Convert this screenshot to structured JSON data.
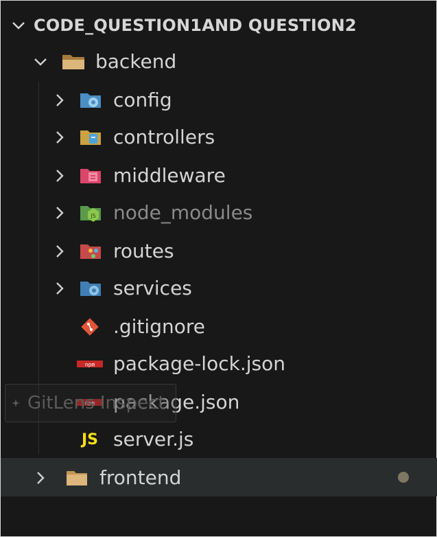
{
  "explorer": {
    "workspace_title": "CODE_QUESTION1AND QUESTION2",
    "backend": {
      "label": "backend",
      "children": [
        {
          "label": "config",
          "icon": "config-folder-icon",
          "dim": false
        },
        {
          "label": "controllers",
          "icon": "controllers-folder-icon",
          "dim": false
        },
        {
          "label": "middleware",
          "icon": "middleware-folder-icon",
          "dim": false
        },
        {
          "label": "node_modules",
          "icon": "node-modules-folder-icon",
          "dim": true
        },
        {
          "label": "routes",
          "icon": "routes-folder-icon",
          "dim": false
        },
        {
          "label": "services",
          "icon": "services-folder-icon",
          "dim": false
        }
      ],
      "files": [
        {
          "label": ".gitignore",
          "icon": "git-icon"
        },
        {
          "label": "package-lock.json",
          "icon": "npm-icon"
        },
        {
          "label": "package.json",
          "icon": "npm-icon"
        },
        {
          "label": "server.js",
          "icon": "js-icon",
          "icon_text": "JS"
        }
      ]
    },
    "frontend": {
      "label": "frontend",
      "status": "modified-dot"
    }
  },
  "gitlens_tooltip": {
    "text": "GitLens Inspect"
  },
  "colors": {
    "background": "#181818",
    "folder": "#c09553",
    "selected_row": "#2a2d2e",
    "js_yellow": "#f5de19"
  }
}
